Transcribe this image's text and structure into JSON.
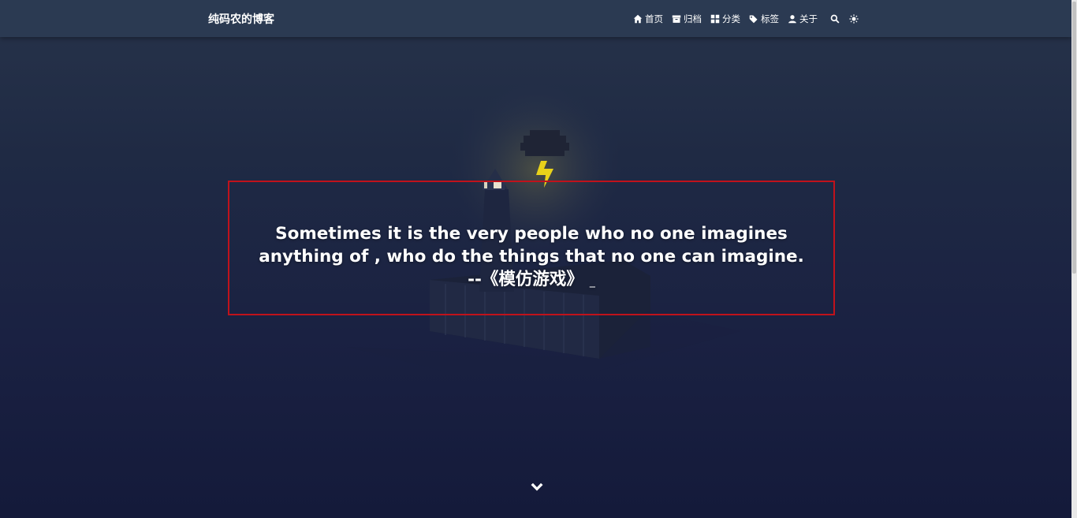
{
  "header": {
    "brand": "纯码农的博客",
    "nav": [
      {
        "label": "首页",
        "icon": "home-icon"
      },
      {
        "label": "归档",
        "icon": "archive-icon"
      },
      {
        "label": "分类",
        "icon": "category-grid-icon"
      },
      {
        "label": "标签",
        "icon": "tags-icon"
      },
      {
        "label": "关于",
        "icon": "user-icon"
      }
    ],
    "search_icon": "search-icon",
    "theme_icon": "sun-icon"
  },
  "hero": {
    "quote_line1": "Sometimes it is the very people who no one imagines",
    "quote_line2": "anything of , who do the things that no one can imagine.",
    "quote_source": "--《模仿游戏》",
    "cursor": "_"
  },
  "colors": {
    "navbar": "#2b3a52",
    "highlight_border": "#c0121b",
    "lightning": "#e8d21a"
  }
}
